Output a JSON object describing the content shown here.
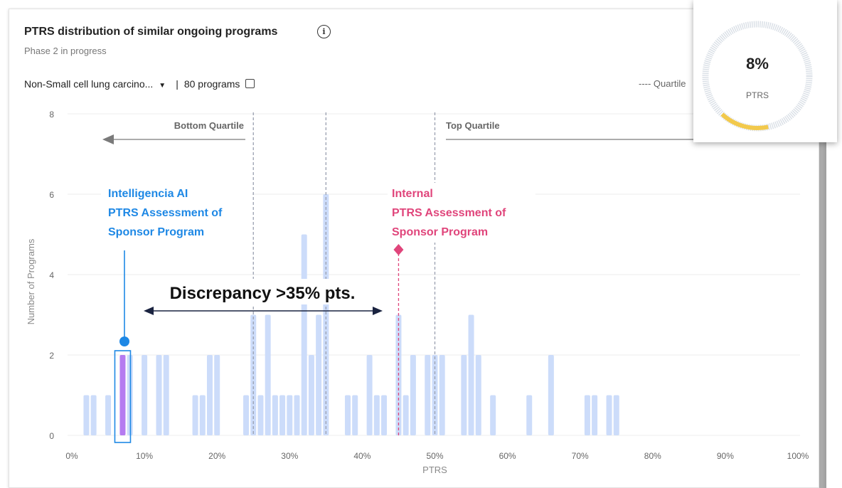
{
  "header": {
    "title": "PTRS distribution of similar ongoing programs",
    "subtitle": "Phase 2 in progress"
  },
  "filter": {
    "indication": "Non-Small cell lung carcino...",
    "separator": "|",
    "programs": "80 programs"
  },
  "legend": {
    "label": "---- Quartile"
  },
  "ptrs_card": {
    "value": "8%",
    "label": "PTRS",
    "value_fraction": 0.08,
    "accent": "#f2c94c"
  },
  "annotations": {
    "bottom_quartile": "Bottom Quartile",
    "top_quartile": "Top Quartile",
    "ai_line1": "Intelligencia AI",
    "ai_line2": "PTRS Assessment of",
    "ai_line3": "Sponsor Program",
    "internal_line1": "Internal",
    "internal_line2": "PTRS Assessment of",
    "internal_line3": "Sponsor Program",
    "discrepancy": "Discrepancy >35% pts."
  },
  "colors": {
    "bar": "#ccdcfa",
    "highlight_bar": "#b57bf0",
    "ai_blue": "#1e88e5",
    "internal_pink": "#e0457b",
    "quartile_line": "#9aa0b0",
    "arrow_dark": "#1a2340"
  },
  "chart_data": {
    "type": "bar",
    "xlabel": "PTRS",
    "ylabel": "Number of Programs",
    "xlim": [
      0,
      100
    ],
    "ylim": [
      0,
      8
    ],
    "x_ticks": [
      "0%",
      "10%",
      "20%",
      "30%",
      "40%",
      "50%",
      "60%",
      "70%",
      "80%",
      "90%",
      "100%"
    ],
    "y_ticks": [
      "0",
      "2",
      "4",
      "6",
      "8"
    ],
    "quartiles": [
      25,
      35,
      50
    ],
    "highlight_x": 7,
    "ai_assessment": 7,
    "internal_assessment": 45,
    "bars": [
      {
        "x": 2,
        "y": 1
      },
      {
        "x": 3,
        "y": 1
      },
      {
        "x": 5,
        "y": 1
      },
      {
        "x": 7,
        "y": 2
      },
      {
        "x": 8,
        "y": 2
      },
      {
        "x": 10,
        "y": 2
      },
      {
        "x": 12,
        "y": 2
      },
      {
        "x": 13,
        "y": 2
      },
      {
        "x": 17,
        "y": 1
      },
      {
        "x": 18,
        "y": 1
      },
      {
        "x": 19,
        "y": 2
      },
      {
        "x": 20,
        "y": 2
      },
      {
        "x": 24,
        "y": 1
      },
      {
        "x": 25,
        "y": 3
      },
      {
        "x": 26,
        "y": 1
      },
      {
        "x": 27,
        "y": 3
      },
      {
        "x": 28,
        "y": 1
      },
      {
        "x": 29,
        "y": 1
      },
      {
        "x": 30,
        "y": 1
      },
      {
        "x": 31,
        "y": 1
      },
      {
        "x": 32,
        "y": 5
      },
      {
        "x": 33,
        "y": 2
      },
      {
        "x": 34,
        "y": 3
      },
      {
        "x": 35,
        "y": 6
      },
      {
        "x": 38,
        "y": 1
      },
      {
        "x": 39,
        "y": 1
      },
      {
        "x": 41,
        "y": 2
      },
      {
        "x": 42,
        "y": 1
      },
      {
        "x": 43,
        "y": 1
      },
      {
        "x": 45,
        "y": 3
      },
      {
        "x": 46,
        "y": 1
      },
      {
        "x": 47,
        "y": 2
      },
      {
        "x": 49,
        "y": 2
      },
      {
        "x": 50,
        "y": 2
      },
      {
        "x": 51,
        "y": 2
      },
      {
        "x": 54,
        "y": 2
      },
      {
        "x": 55,
        "y": 3
      },
      {
        "x": 56,
        "y": 2
      },
      {
        "x": 58,
        "y": 1
      },
      {
        "x": 63,
        "y": 1
      },
      {
        "x": 66,
        "y": 2
      },
      {
        "x": 71,
        "y": 1
      },
      {
        "x": 72,
        "y": 1
      },
      {
        "x": 74,
        "y": 1
      },
      {
        "x": 75,
        "y": 1
      }
    ]
  }
}
